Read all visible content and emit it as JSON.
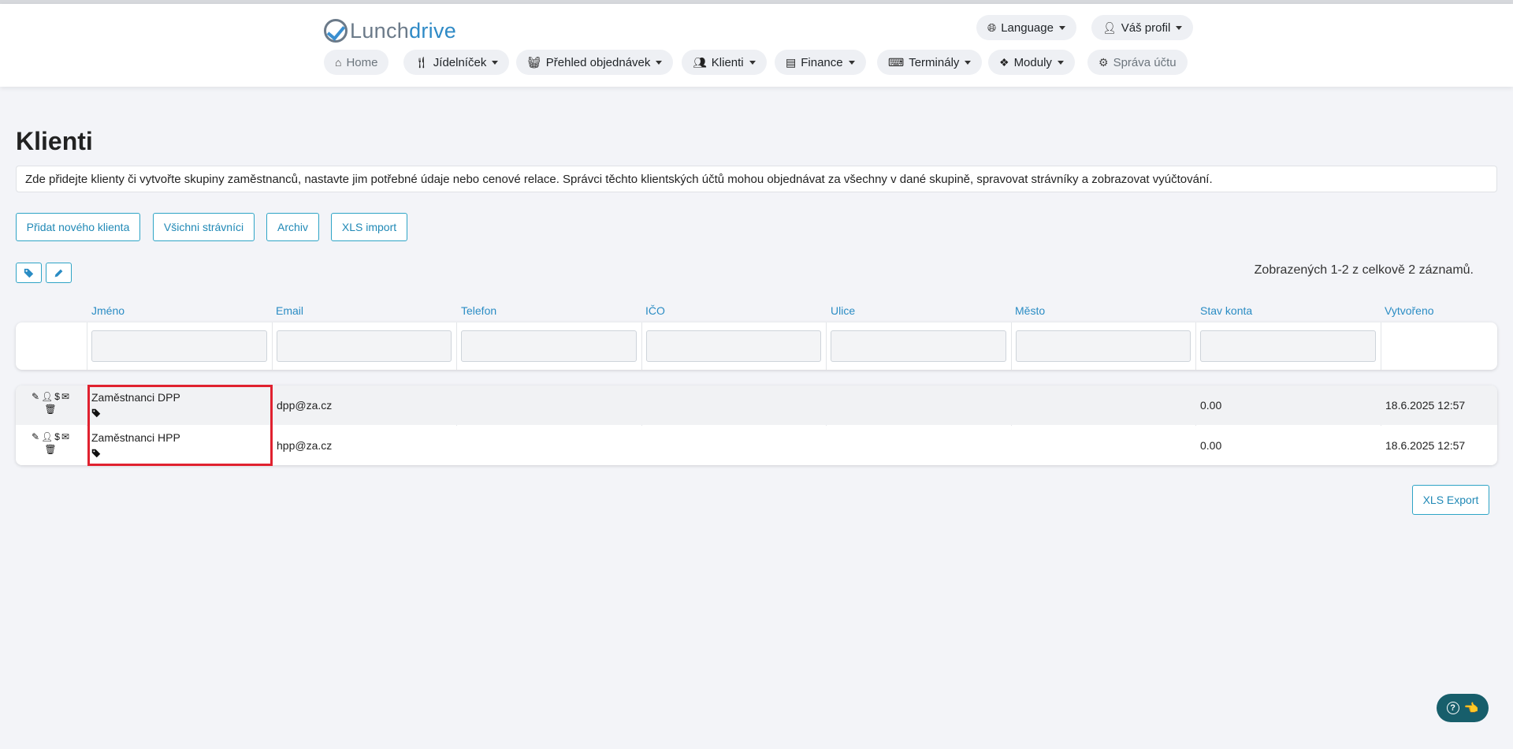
{
  "brand": {
    "part1": "Lunch",
    "part2": "drive"
  },
  "top_menu": {
    "language": {
      "label": "Language",
      "icon": "globe-icon"
    },
    "profile": {
      "label": "Váš profil",
      "icon": "user-icon"
    }
  },
  "nav": [
    {
      "label": "Home",
      "icon": "home-icon",
      "has_caret": false
    },
    {
      "label": "Jídelníček",
      "icon": "utensils-icon",
      "has_caret": true
    },
    {
      "label": "Přehled objednávek",
      "icon": "basket-icon",
      "has_caret": true
    },
    {
      "label": "Klienti",
      "icon": "users-icon",
      "has_caret": true
    },
    {
      "label": "Finance",
      "icon": "cash-register-icon",
      "has_caret": true
    },
    {
      "label": "Terminály",
      "icon": "keyboard-icon",
      "has_caret": true
    },
    {
      "label": "Moduly",
      "icon": "cubes-icon",
      "has_caret": true
    },
    {
      "label": "Správa účtu",
      "icon": "gear-icon",
      "has_caret": false
    }
  ],
  "page": {
    "title": "Klienti",
    "description": "Zde přidejte klienty či vytvořte skupiny zaměstnanců, nastavte jim potřebné údaje nebo cenové relace. Správci těchto klientských účtů mohou objednávat za všechny v dané skupině, spravovat strávníky a zobrazovat vyúčtování."
  },
  "actions": {
    "add_client": "Přidat nového klienta",
    "all_diners": "Všichni strávníci",
    "archive": "Archiv",
    "xls_import": "XLS import",
    "xls_export": "XLS Export"
  },
  "summary": "Zobrazených 1-2 z celkově 2 záznamů.",
  "table": {
    "columns": [
      "Jméno",
      "Email",
      "Telefon",
      "IČO",
      "Ulice",
      "Město",
      "Stav konta",
      "Vytvořeno"
    ],
    "rows": [
      {
        "name": "Zaměstnanci DPP",
        "email": "dpp@za.cz",
        "phone": "",
        "ico": "",
        "street": "",
        "city": "",
        "balance": "0.00",
        "created": "18.6.2025 12:57"
      },
      {
        "name": "Zaměstnanci HPP",
        "email": "hpp@za.cz",
        "phone": "",
        "ico": "",
        "street": "",
        "city": "",
        "balance": "0.00",
        "created": "18.6.2025 12:57"
      }
    ]
  },
  "help": {
    "icon": "question-circle-icon",
    "emoji": "👈"
  },
  "colors": {
    "accent": "#2a8cc4",
    "highlight": "#e0212f",
    "help_bg": "#175e6b"
  }
}
